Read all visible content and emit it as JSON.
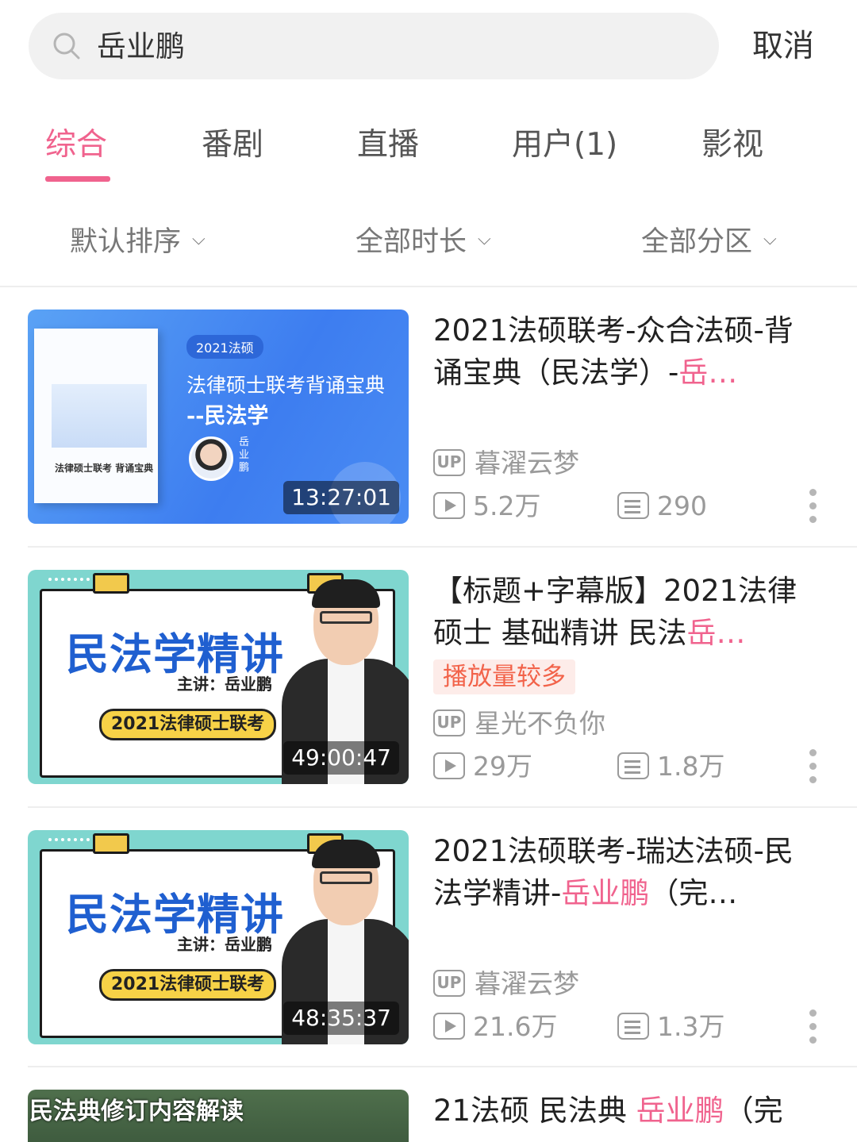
{
  "search": {
    "query": "岳业鹏",
    "cancel_label": "取消"
  },
  "tabs": [
    {
      "label": "综合",
      "active": true
    },
    {
      "label": "番剧"
    },
    {
      "label": "直播"
    },
    {
      "label": "用户(1)"
    },
    {
      "label": "影视"
    }
  ],
  "filters": [
    {
      "label": "默认排序"
    },
    {
      "label": "全部时长"
    },
    {
      "label": "全部分区"
    }
  ],
  "accent_color": "#f0638e",
  "results": [
    {
      "title_plain": "2021法硕联考-众合法硕-背诵宝典（民法学）-",
      "title_highlight": "岳…",
      "duration": "13:27:01",
      "up_label": "UP",
      "uploader": "暮濯云梦",
      "views": "5.2万",
      "danmaku": "290",
      "thumb": {
        "pill": "2021法硕",
        "line1": "法律硕士联考背诵宝典",
        "line2": "--民法学",
        "name_vertical": "岳业鹏",
        "book_title": "法律硕士联考 背诵宝典"
      }
    },
    {
      "title_plain": "【标题+字幕版】2021法律硕士 基础精讲 民法",
      "title_highlight": "岳…",
      "badge": "播放量较多",
      "duration": "49:00:47",
      "up_label": "UP",
      "uploader": "星光不负你",
      "views": "29万",
      "danmaku": "1.8万",
      "thumb": {
        "big": "民法学精讲",
        "teacher": "主讲：岳业鹏",
        "yellow": "2021法律硕士联考"
      }
    },
    {
      "title_plain": "2021法硕联考-瑞达法硕-民法学精讲-",
      "title_highlight": "岳业鹏",
      "title_tail": "（完…",
      "duration": "48:35:37",
      "up_label": "UP",
      "uploader": "暮濯云梦",
      "views": "21.6万",
      "danmaku": "1.3万",
      "thumb": {
        "big": "民法学精讲",
        "teacher": "主讲：岳业鹏",
        "yellow": "2021法律硕士联考"
      }
    },
    {
      "title_plain": "21法硕 民法典 ",
      "title_highlight": "岳业鹏",
      "title_tail": "（完",
      "thumb": {
        "caption": "民法典修订内容解读"
      }
    }
  ]
}
